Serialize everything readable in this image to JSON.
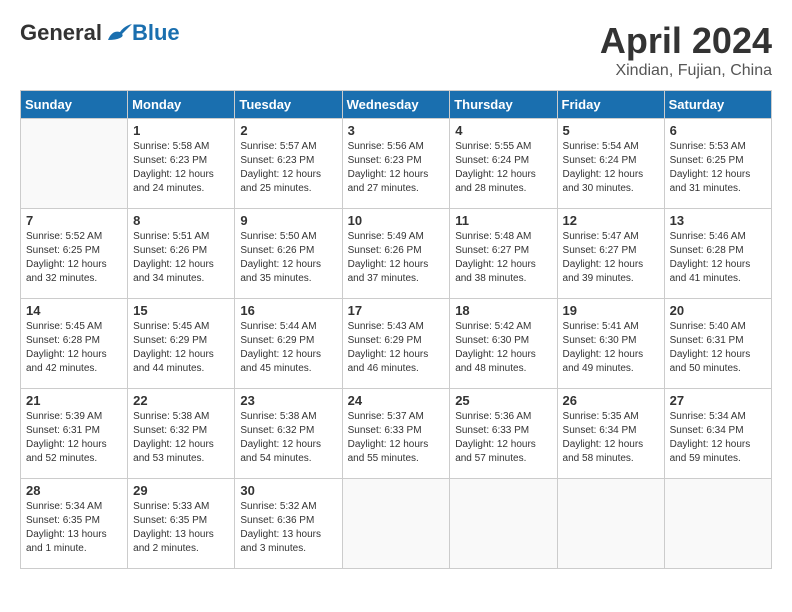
{
  "logo": {
    "general": "General",
    "blue": "Blue"
  },
  "header": {
    "month_title": "April 2024",
    "location": "Xindian, Fujian, China"
  },
  "days_of_week": [
    "Sunday",
    "Monday",
    "Tuesday",
    "Wednesday",
    "Thursday",
    "Friday",
    "Saturday"
  ],
  "weeks": [
    [
      {
        "day": "",
        "info": ""
      },
      {
        "day": "1",
        "info": "Sunrise: 5:58 AM\nSunset: 6:23 PM\nDaylight: 12 hours\nand 24 minutes."
      },
      {
        "day": "2",
        "info": "Sunrise: 5:57 AM\nSunset: 6:23 PM\nDaylight: 12 hours\nand 25 minutes."
      },
      {
        "day": "3",
        "info": "Sunrise: 5:56 AM\nSunset: 6:23 PM\nDaylight: 12 hours\nand 27 minutes."
      },
      {
        "day": "4",
        "info": "Sunrise: 5:55 AM\nSunset: 6:24 PM\nDaylight: 12 hours\nand 28 minutes."
      },
      {
        "day": "5",
        "info": "Sunrise: 5:54 AM\nSunset: 6:24 PM\nDaylight: 12 hours\nand 30 minutes."
      },
      {
        "day": "6",
        "info": "Sunrise: 5:53 AM\nSunset: 6:25 PM\nDaylight: 12 hours\nand 31 minutes."
      }
    ],
    [
      {
        "day": "7",
        "info": "Sunrise: 5:52 AM\nSunset: 6:25 PM\nDaylight: 12 hours\nand 32 minutes."
      },
      {
        "day": "8",
        "info": "Sunrise: 5:51 AM\nSunset: 6:26 PM\nDaylight: 12 hours\nand 34 minutes."
      },
      {
        "day": "9",
        "info": "Sunrise: 5:50 AM\nSunset: 6:26 PM\nDaylight: 12 hours\nand 35 minutes."
      },
      {
        "day": "10",
        "info": "Sunrise: 5:49 AM\nSunset: 6:26 PM\nDaylight: 12 hours\nand 37 minutes."
      },
      {
        "day": "11",
        "info": "Sunrise: 5:48 AM\nSunset: 6:27 PM\nDaylight: 12 hours\nand 38 minutes."
      },
      {
        "day": "12",
        "info": "Sunrise: 5:47 AM\nSunset: 6:27 PM\nDaylight: 12 hours\nand 39 minutes."
      },
      {
        "day": "13",
        "info": "Sunrise: 5:46 AM\nSunset: 6:28 PM\nDaylight: 12 hours\nand 41 minutes."
      }
    ],
    [
      {
        "day": "14",
        "info": "Sunrise: 5:45 AM\nSunset: 6:28 PM\nDaylight: 12 hours\nand 42 minutes."
      },
      {
        "day": "15",
        "info": "Sunrise: 5:45 AM\nSunset: 6:29 PM\nDaylight: 12 hours\nand 44 minutes."
      },
      {
        "day": "16",
        "info": "Sunrise: 5:44 AM\nSunset: 6:29 PM\nDaylight: 12 hours\nand 45 minutes."
      },
      {
        "day": "17",
        "info": "Sunrise: 5:43 AM\nSunset: 6:29 PM\nDaylight: 12 hours\nand 46 minutes."
      },
      {
        "day": "18",
        "info": "Sunrise: 5:42 AM\nSunset: 6:30 PM\nDaylight: 12 hours\nand 48 minutes."
      },
      {
        "day": "19",
        "info": "Sunrise: 5:41 AM\nSunset: 6:30 PM\nDaylight: 12 hours\nand 49 minutes."
      },
      {
        "day": "20",
        "info": "Sunrise: 5:40 AM\nSunset: 6:31 PM\nDaylight: 12 hours\nand 50 minutes."
      }
    ],
    [
      {
        "day": "21",
        "info": "Sunrise: 5:39 AM\nSunset: 6:31 PM\nDaylight: 12 hours\nand 52 minutes."
      },
      {
        "day": "22",
        "info": "Sunrise: 5:38 AM\nSunset: 6:32 PM\nDaylight: 12 hours\nand 53 minutes."
      },
      {
        "day": "23",
        "info": "Sunrise: 5:38 AM\nSunset: 6:32 PM\nDaylight: 12 hours\nand 54 minutes."
      },
      {
        "day": "24",
        "info": "Sunrise: 5:37 AM\nSunset: 6:33 PM\nDaylight: 12 hours\nand 55 minutes."
      },
      {
        "day": "25",
        "info": "Sunrise: 5:36 AM\nSunset: 6:33 PM\nDaylight: 12 hours\nand 57 minutes."
      },
      {
        "day": "26",
        "info": "Sunrise: 5:35 AM\nSunset: 6:34 PM\nDaylight: 12 hours\nand 58 minutes."
      },
      {
        "day": "27",
        "info": "Sunrise: 5:34 AM\nSunset: 6:34 PM\nDaylight: 12 hours\nand 59 minutes."
      }
    ],
    [
      {
        "day": "28",
        "info": "Sunrise: 5:34 AM\nSunset: 6:35 PM\nDaylight: 13 hours\nand 1 minute."
      },
      {
        "day": "29",
        "info": "Sunrise: 5:33 AM\nSunset: 6:35 PM\nDaylight: 13 hours\nand 2 minutes."
      },
      {
        "day": "30",
        "info": "Sunrise: 5:32 AM\nSunset: 6:36 PM\nDaylight: 13 hours\nand 3 minutes."
      },
      {
        "day": "",
        "info": ""
      },
      {
        "day": "",
        "info": ""
      },
      {
        "day": "",
        "info": ""
      },
      {
        "day": "",
        "info": ""
      }
    ]
  ]
}
